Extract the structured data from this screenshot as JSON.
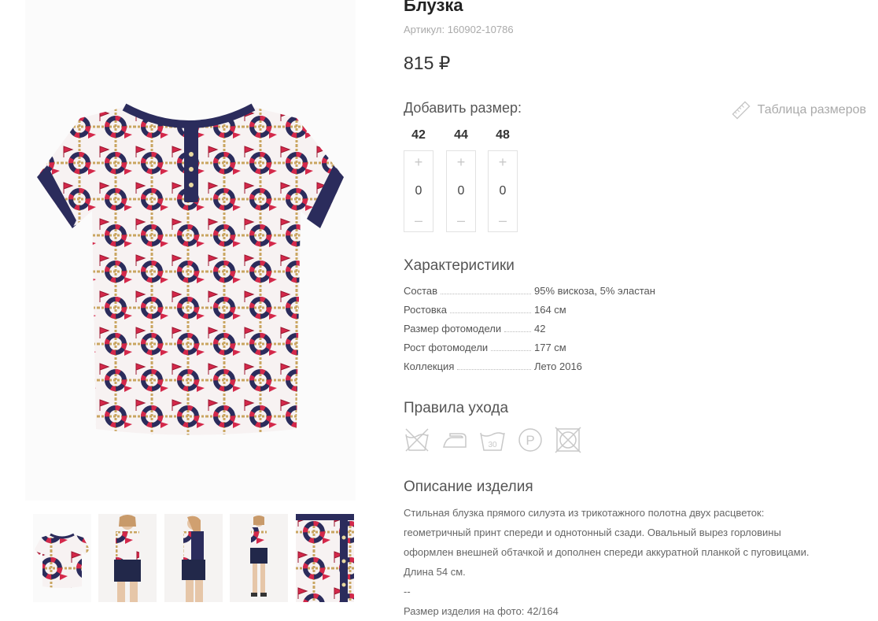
{
  "product": {
    "title": "Блузка",
    "sku": "Артикул: 160902-10786",
    "price": "815 ₽"
  },
  "sizes": {
    "heading": "Добавить размер:",
    "table_link": "Таблица размеров",
    "items": [
      {
        "size": "42",
        "qty": "0",
        "plus": "+",
        "minus": "–"
      },
      {
        "size": "44",
        "qty": "0",
        "plus": "+",
        "minus": "–"
      },
      {
        "size": "48",
        "qty": "0",
        "plus": "+",
        "minus": "–"
      }
    ]
  },
  "characteristics": {
    "heading": "Характеристики",
    "rows": [
      {
        "key": "Состав",
        "value": "95% вискоза, 5% эластан"
      },
      {
        "key": "Ростовка",
        "value": "164 см"
      },
      {
        "key": "Размер фотомодели",
        "value": "42"
      },
      {
        "key": "Рост фотомодели",
        "value": "177 см"
      },
      {
        "key": "Коллекция",
        "value": "Лето 2016"
      }
    ]
  },
  "care": {
    "heading": "Правила ухода",
    "icons": [
      "no-wash-icon",
      "iron-icon",
      "wash-30-icon",
      "professional-clean-p-icon",
      "no-tumble-dry-icon"
    ],
    "wash_temp": "30",
    "clean_letter": "P"
  },
  "description": {
    "heading": "Описание изделия",
    "lines": [
      "Стильная блузка прямого силуэта из трикотажного полотна двух расцветок:",
      "геометричный принт спереди и однотонный сзади. Овальный вырез горловины",
      "оформлен внешней обтачкой и дополнен спереди аккуратной планкой с пуговицами.",
      "Длина 54 см.",
      "--",
      "Размер изделия на фото: 42/164"
    ]
  },
  "gallery": {
    "thumbnails": [
      "blouse-front",
      "model-front-shorts",
      "model-side",
      "model-full-length",
      "fabric-closeup"
    ],
    "active_index": 0
  },
  "colors": {
    "accent": "#3bc9bb",
    "navy": "#2b2c5c",
    "red": "#d4284a",
    "rope": "#c9a560"
  }
}
